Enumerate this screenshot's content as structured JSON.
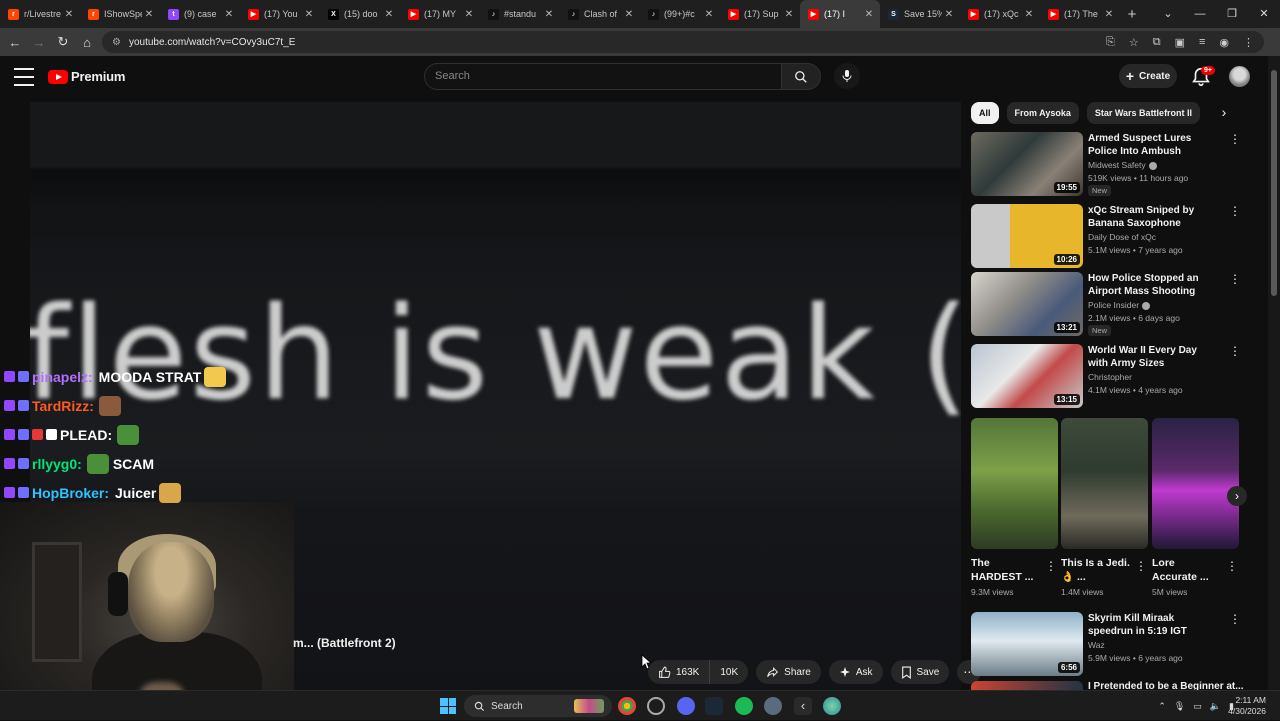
{
  "browser": {
    "tabs": [
      {
        "label": "r/Livestre",
        "color": "#ff4500",
        "glyph": "r"
      },
      {
        "label": "IShowSpe",
        "color": "#ff4500",
        "glyph": "r"
      },
      {
        "label": "(9) case",
        "color": "#9146ff",
        "glyph": "t"
      },
      {
        "label": "(17) You",
        "color": "#ff0000",
        "glyph": "▶"
      },
      {
        "label": "(15) doo",
        "color": "#000000",
        "glyph": "X"
      },
      {
        "label": "(17) MY",
        "color": "#ff0000",
        "glyph": "▶"
      },
      {
        "label": "#standu",
        "color": "#111111",
        "glyph": "♪"
      },
      {
        "label": "Clash of",
        "color": "#111111",
        "glyph": "♪"
      },
      {
        "label": "(99+)#c",
        "color": "#111111",
        "glyph": "♪"
      },
      {
        "label": "(17) Sup",
        "color": "#ff0000",
        "glyph": "▶"
      },
      {
        "label": "(17) I",
        "color": "#ff0000",
        "glyph": "▶",
        "active": true
      },
      {
        "label": "Save 15%",
        "color": "#1b2838",
        "glyph": "S"
      },
      {
        "label": "(17) xQc",
        "color": "#ff0000",
        "glyph": "▶"
      },
      {
        "label": "(17) The",
        "color": "#ff0000",
        "glyph": "▶"
      }
    ],
    "url": "youtube.com/watch?v=COvy3uC7t_E"
  },
  "header": {
    "logo_text": "Premium",
    "search_placeholder": "Search",
    "create_label": "Create",
    "notification_count": "9+"
  },
  "video": {
    "caption_text": "flesh is weak (",
    "title_fragment": "m... (Battlefront 2)"
  },
  "chat": [
    {
      "user": "pinapelz:",
      "msg": "MOODA STRAT",
      "color": "#b070ff",
      "emote": "#f2c94c"
    },
    {
      "user": "TardRizz:",
      "msg": "",
      "color": "#ff5a1f",
      "emote": "#8b5a3c"
    },
    {
      "user": "PLEAD:",
      "msg": "",
      "color": "#ffffff",
      "emote": "#4a8f3a",
      "prefix_badges": [
        "#e53935",
        "#ffffff"
      ]
    },
    {
      "user": "rllyyg0:",
      "msg": "SCAM",
      "color": "#00e676",
      "emote": "#4a8f3a",
      "emote_before_msg": true
    },
    {
      "user": "HopBroker:",
      "msg": "Juicer",
      "color": "#2ec4ff",
      "emote": "#d9a64a"
    }
  ],
  "actions": {
    "likes": "163K",
    "dislikes": "10K",
    "share": "Share",
    "ask": "Ask",
    "save": "Save"
  },
  "sidebar": {
    "chips": [
      "All",
      "From Aysoka",
      "Star Wars Battlefront II"
    ],
    "recs": [
      {
        "title": "Armed Suspect Lures Police Into Ambush",
        "channel": "Midwest Safety",
        "verified": true,
        "meta": "519K views • 11 hours ago",
        "badge": "New",
        "duration": "19:55",
        "thumb": "linear-gradient(135deg,#6d6a5f,#2f3a3a 40%,#8a8176 70%,#3b3630)"
      },
      {
        "title": "xQc Stream Sniped by Banana Saxophone Compilation ft. Ju...",
        "channel": "Daily Dose of xQc",
        "verified": false,
        "meta": "5.1M views • 7 years ago",
        "badge": "",
        "duration": "10:26",
        "thumb": "linear-gradient(90deg,#c9c9c9 0 35%,#e7b62a 35% 100%)"
      },
      {
        "title": "How Police Stopped an Airport Mass Shooting",
        "channel": "Police Insider",
        "verified": true,
        "meta": "2.1M views • 6 days ago",
        "badge": "New",
        "duration": "13:21",
        "thumb": "linear-gradient(135deg,#d8d4ce,#8f8c88 40%,#4a5a7a 70%,#6e6a66)"
      },
      {
        "title": "World War II Every Day with Army Sizes",
        "channel": "Christopher",
        "verified": false,
        "meta": "4.1M views • 4 years ago",
        "badge": "",
        "duration": "13:15",
        "thumb": "linear-gradient(135deg,#b9c4d1,#e8e8e8 40%,#c24a4a 60%,#c9c9c9)"
      },
      {
        "title": "Skyrim Kill Miraak speedrun in 5:19 IGT",
        "channel": "Waz",
        "verified": false,
        "meta": "5.9M views • 6 years ago",
        "badge": "",
        "duration": "6:56",
        "thumb": "linear-gradient(180deg,#8fb1c9,#dfe9ef 45%,#6b7c86)"
      }
    ],
    "next_title_partial": "I Pretended to be a Beginner at...",
    "shorts": [
      {
        "title": "The HARDEST ...",
        "views": "9.3M views",
        "thumb": "linear-gradient(180deg,#55753a,#7da048 40%,#4c6a2f 70%,#2d3b23)"
      },
      {
        "title": "This Is a Jedi. 👌 ...",
        "views": "1.4M views",
        "thumb": "linear-gradient(180deg,#3e4a3a,#2f3b2f 40%,#6f6a5b 75%,#2a2a26)"
      },
      {
        "title": "Lore Accurate ...",
        "views": "5M views",
        "thumb": "linear-gradient(180deg,#2a2244,#5a2a6a 40%,#c03ad0 55%,#201836)"
      }
    ]
  },
  "taskbar": {
    "search_label": "Search",
    "time": "2:11 AM",
    "date": "4/30/2026"
  }
}
